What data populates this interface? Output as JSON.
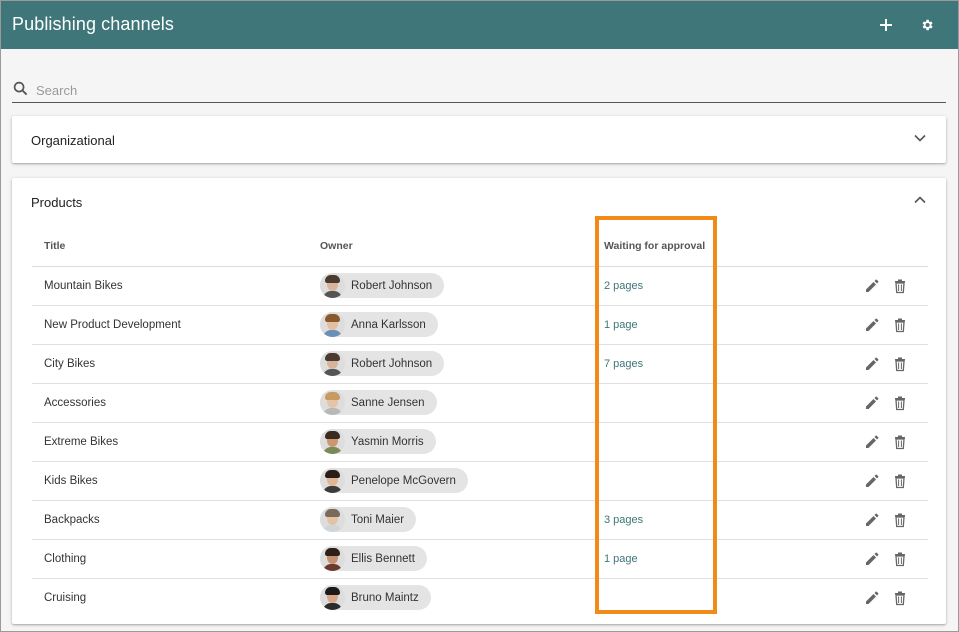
{
  "header": {
    "title": "Publishing channels",
    "add_icon": "plus-icon",
    "settings_icon": "gear-icon",
    "color": "#3e7679"
  },
  "search": {
    "placeholder": "Search",
    "value": "",
    "icon": "search-icon"
  },
  "sections": [
    {
      "label": "Organizational",
      "expanded": false,
      "icon": "chevron-down-icon"
    },
    {
      "label": "Products",
      "expanded": true,
      "icon": "chevron-up-icon",
      "columns": {
        "title": "Title",
        "owner": "Owner",
        "waiting": "Waiting for approval"
      },
      "rows": [
        {
          "title": "Mountain Bikes",
          "owner": "Robert Johnson",
          "waiting": "2 pages"
        },
        {
          "title": "New Product Development",
          "owner": "Anna Karlsson",
          "waiting": "1 page"
        },
        {
          "title": "City Bikes",
          "owner": "Robert Johnson",
          "waiting": "7 pages"
        },
        {
          "title": "Accessories",
          "owner": "Sanne Jensen",
          "waiting": ""
        },
        {
          "title": "Extreme Bikes",
          "owner": "Yasmin Morris",
          "waiting": ""
        },
        {
          "title": "Kids Bikes",
          "owner": "Penelope McGovern",
          "waiting": ""
        },
        {
          "title": "Backpacks",
          "owner": "Toni Maier",
          "waiting": "3 pages"
        },
        {
          "title": "Clothing",
          "owner": "Ellis Bennett",
          "waiting": "1 page"
        },
        {
          "title": "Cruising",
          "owner": "Bruno Maintz",
          "waiting": ""
        }
      ]
    }
  ],
  "row_actions": {
    "edit_icon": "pencil-icon",
    "delete_icon": "trash-icon"
  },
  "highlight_color": "#f28a1a"
}
